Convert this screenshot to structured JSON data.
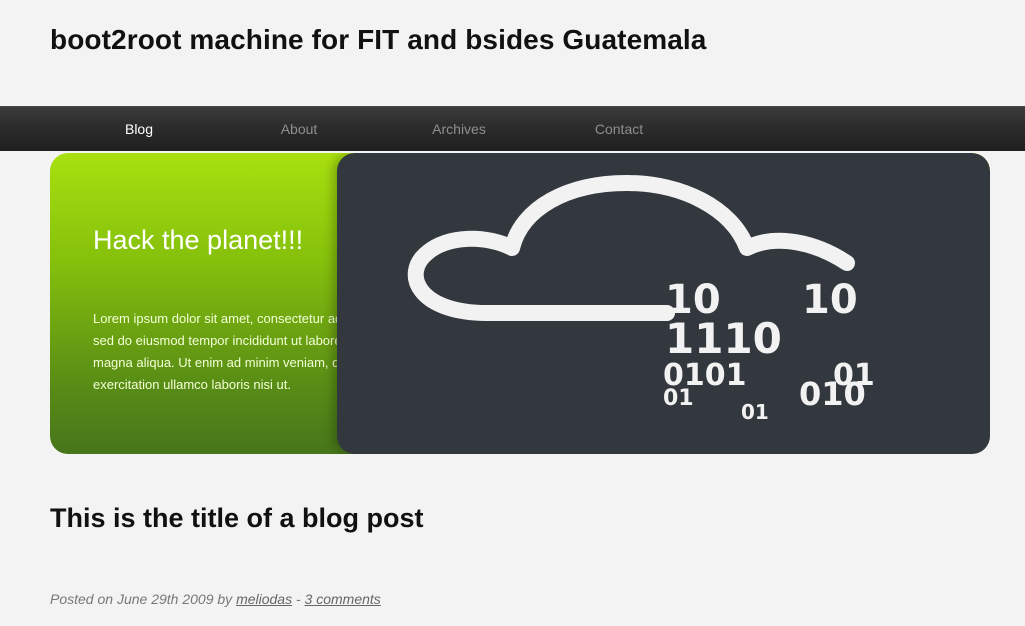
{
  "site": {
    "title": "boot2root machine for FIT and bsides Guatemala"
  },
  "nav": {
    "items": [
      {
        "label": "Blog",
        "active": true
      },
      {
        "label": "About",
        "active": false
      },
      {
        "label": "Archives",
        "active": false
      },
      {
        "label": "Contact",
        "active": false
      }
    ]
  },
  "hero": {
    "heading": "Hack the planet!!!",
    "text": "Lorem ipsum dolor sit amet, consectetur adipisicing elit, sed do eiusmod tempor incididunt ut labore et dolore magna aliqua. Ut enim ad minim veniam, quis nostrud exercitation ullamco laboris nisi ut.",
    "image": {
      "icon": "cloud-binary-icon",
      "digit_rows": [
        "10",
        "10",
        "1110",
        "0101",
        "01",
        "01",
        "010",
        "01"
      ],
      "background_color": "#32383e",
      "panel_gradient": [
        "#a8e00f",
        "#46751a"
      ]
    }
  },
  "post": {
    "title": "This is the title of a blog post",
    "meta": {
      "posted_prefix": "Posted on",
      "date": "June 29th 2009",
      "by": "by",
      "author": "meliodas",
      "separator": "-",
      "comments": "3 comments"
    }
  }
}
